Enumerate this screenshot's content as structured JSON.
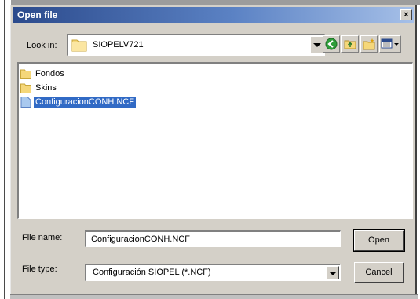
{
  "dialog": {
    "title": "Open file",
    "close_glyph": "×"
  },
  "look_in": {
    "label": "Look in:",
    "value": "SIOPELV721"
  },
  "toolbar": {
    "icons": [
      "back-icon",
      "up-folder-icon",
      "new-folder-icon",
      "view-menu-icon"
    ]
  },
  "files": {
    "items": [
      {
        "name": "Fondos",
        "type": "folder",
        "selected": false
      },
      {
        "name": "Skins",
        "type": "folder",
        "selected": false
      },
      {
        "name": "ConfiguracionCONH.NCF",
        "type": "file",
        "selected": true
      }
    ]
  },
  "file_name": {
    "label": "File name:",
    "value": "ConfiguracionCONH.NCF"
  },
  "file_type": {
    "label": "File type:",
    "value": "Configuración SIOPEL (*.NCF)"
  },
  "buttons": {
    "open": "Open",
    "cancel": "Cancel"
  },
  "colors": {
    "title_start": "#2b4a8c",
    "selection": "#316ac5",
    "face": "#d4d0c8"
  }
}
